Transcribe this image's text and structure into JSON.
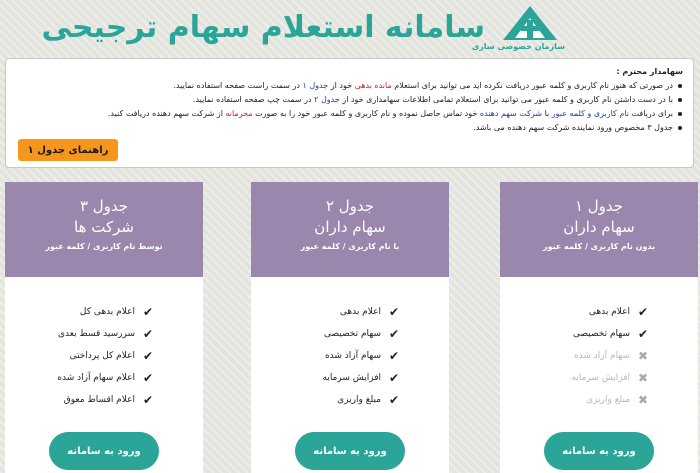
{
  "header": {
    "title": "سامانه استعلام سهام ترجیحی",
    "logo_text": "سازمان خصوصی سازی"
  },
  "notice": {
    "title": "سهامدار محترم :",
    "items": [
      {
        "before": "در صورتی که هنوز نام کاربری و کلمه عبور دریافت نکرده اید می توانید برای استعلام ",
        "hl1": "مانده بدهی",
        "mid": " خود از ",
        "hl2": "جدول ۱",
        "after": " در سمت راست صفحه استفاده نمایید."
      },
      {
        "before": "با در دست داشتن نام کاربری و کلمه عبور می توانید برای استعلام تمامی اطلاعات سهامداری خود از ",
        "hl1": "جدول ۲",
        "mid": " در سمت چپ صفحه استفاده نمایید.",
        "hl2": "",
        "after": ""
      },
      {
        "before": "برای دریافت ",
        "hl1": "نام کاربری و کلمه عبور",
        "mid": " با ",
        "hl2": "شرکت سهم دهنده",
        "after": " خود تماس حاصل نموده و نام کاربری و کلمه عبور خود را به صورت ",
        "hl3": "محرمانه",
        "end": " از شرکت سهم دهنده دریافت کنید."
      },
      {
        "before": "جدول ۳ مخصوص ورود نماینده شرکت سهم دهنده می باشد.",
        "hl1": "",
        "mid": "",
        "hl2": "",
        "after": ""
      }
    ],
    "guide_button": "راهنمای جدول ۱"
  },
  "cards": [
    {
      "title": "جدول ۱",
      "subtitle": "سهام داران",
      "desc": "بدون نام کاربری / کلمه عبور",
      "features": [
        {
          "label": "اعلام بدهی",
          "enabled": true
        },
        {
          "label": "سهام تخصیصی",
          "enabled": true
        },
        {
          "label": "سهام آزاد شده",
          "enabled": false
        },
        {
          "label": "افزایش سرمایه",
          "enabled": false
        },
        {
          "label": "مبلغ واریزی",
          "enabled": false
        }
      ],
      "button": "ورود به سامانه"
    },
    {
      "title": "جدول ۲",
      "subtitle": "سهام داران",
      "desc": "با نام کاربری / کلمه عبور",
      "features": [
        {
          "label": "اعلام بدهی",
          "enabled": true
        },
        {
          "label": "سهام تخصیصی",
          "enabled": true
        },
        {
          "label": "سهام آزاد شده",
          "enabled": true
        },
        {
          "label": "افزایش سرمایه",
          "enabled": true
        },
        {
          "label": "مبلغ واریزی",
          "enabled": true
        }
      ],
      "button": "ورود به سامانه"
    },
    {
      "title": "جدول ۳",
      "subtitle": "شرکت ها",
      "desc": "توسط نام کاربری / کلمه عبور",
      "features": [
        {
          "label": "اعلام بدهی کل",
          "enabled": true
        },
        {
          "label": "سررسید قسط بعدی",
          "enabled": true
        },
        {
          "label": "اعلام کل پرداختی",
          "enabled": true
        },
        {
          "label": "اعلام سهام آزاد شده",
          "enabled": true
        },
        {
          "label": "اعلام اقساط معوق",
          "enabled": true
        }
      ],
      "button": "ورود به سامانه"
    }
  ],
  "icons": {
    "check": "check-icon",
    "cross": "cross-icon"
  },
  "colors": {
    "brand_teal": "#2aa597",
    "card_header": "#9b87ad",
    "guide_button": "#f7961d",
    "highlight_blue": "#1a3fa8",
    "highlight_red": "#c0282a"
  }
}
